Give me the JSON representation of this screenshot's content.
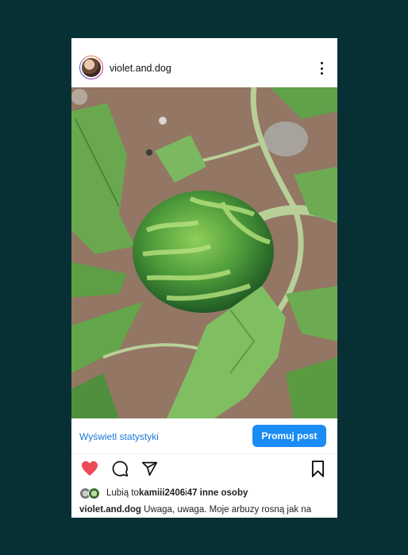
{
  "post": {
    "username": "violet.and.dog",
    "stats_link": "Wyświetl statystyki",
    "promote_button": "Promuj post",
    "likes": {
      "prefix": "Lubią to ",
      "user": "kamiii2406",
      "middle": " i ",
      "others": "47 inne osoby"
    },
    "caption": {
      "username": "violet.and.dog",
      "text": " Uwaga, uwaga. Moje arbuzy rosną jak na"
    }
  },
  "icons": {
    "like": "heart-icon",
    "comment": "comment-icon",
    "share": "send-icon",
    "save": "bookmark-icon",
    "more": "more-vertical-icon"
  },
  "colors": {
    "background": "#063033",
    "link": "#1a78d6",
    "promote_button": "#1a8cf5",
    "like_heart": "#ed4956"
  }
}
